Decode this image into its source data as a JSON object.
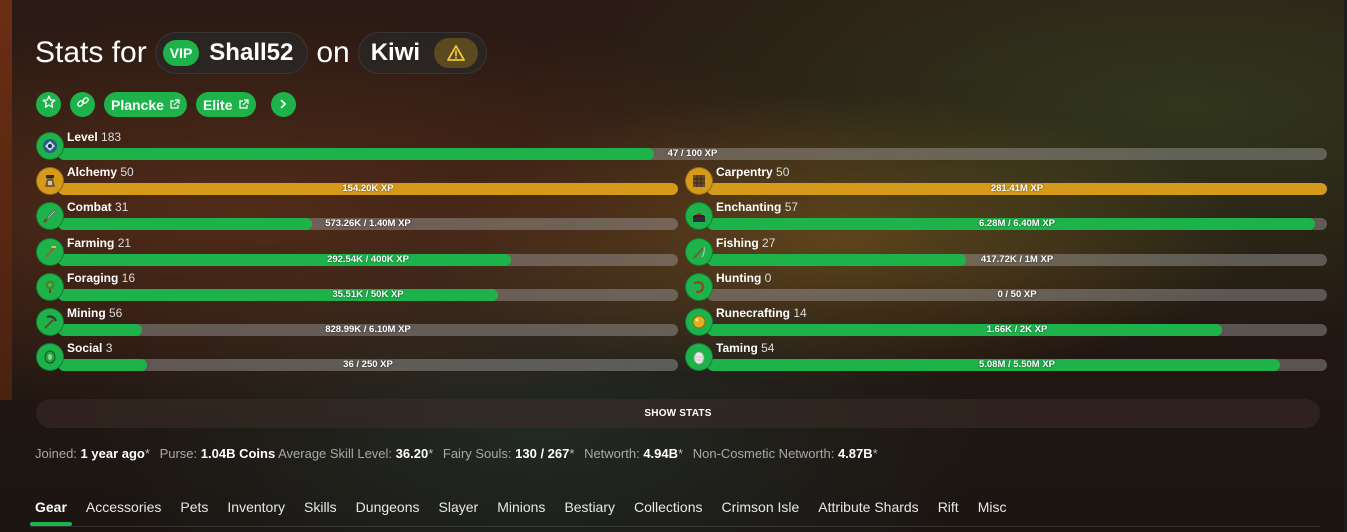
{
  "header": {
    "stats_for": "Stats for",
    "vip": "VIP",
    "username": "Shall52",
    "on": "on",
    "profile": "Kiwi"
  },
  "links": {
    "plancke": "Plancke",
    "elite": "Elite"
  },
  "level": {
    "name": "Level",
    "level": "183",
    "xp": "47 / 100 XP",
    "progress": 0.47
  },
  "skills_left": [
    {
      "name": "Alchemy",
      "level": "50",
      "xp": "154.20K XP",
      "progress": 1.0,
      "max": true,
      "icon": "alchemy-icon"
    },
    {
      "name": "Combat",
      "level": "31",
      "xp": "573.26K / 1.40M XP",
      "progress": 0.41,
      "max": false,
      "icon": "combat-icon"
    },
    {
      "name": "Farming",
      "level": "21",
      "xp": "292.54K / 400K XP",
      "progress": 0.73,
      "max": false,
      "icon": "farming-icon"
    },
    {
      "name": "Foraging",
      "level": "16",
      "xp": "35.51K / 50K XP",
      "progress": 0.71,
      "max": false,
      "icon": "foraging-icon"
    },
    {
      "name": "Mining",
      "level": "56",
      "xp": "828.99K / 6.10M XP",
      "progress": 0.136,
      "max": false,
      "icon": "mining-icon"
    },
    {
      "name": "Social",
      "level": "3",
      "xp": "36 / 250 XP",
      "progress": 0.144,
      "max": false,
      "icon": "social-icon"
    }
  ],
  "skills_right": [
    {
      "name": "Carpentry",
      "level": "50",
      "xp": "281.41M XP",
      "progress": 1.0,
      "max": true,
      "icon": "carpentry-icon"
    },
    {
      "name": "Enchanting",
      "level": "57",
      "xp": "6.28M / 6.40M XP",
      "progress": 0.981,
      "max": false,
      "icon": "enchanting-icon"
    },
    {
      "name": "Fishing",
      "level": "27",
      "xp": "417.72K / 1M XP",
      "progress": 0.418,
      "max": false,
      "icon": "fishing-icon"
    },
    {
      "name": "Hunting",
      "level": "0",
      "xp": "0 / 50 XP",
      "progress": 0.0,
      "max": false,
      "icon": "hunting-icon"
    },
    {
      "name": "Runecrafting",
      "level": "14",
      "xp": "1.66K / 2K XP",
      "progress": 0.83,
      "max": false,
      "icon": "runecrafting-icon"
    },
    {
      "name": "Taming",
      "level": "54",
      "xp": "5.08M / 5.50M XP",
      "progress": 0.924,
      "max": false,
      "icon": "taming-icon"
    }
  ],
  "show_stats": "SHOW STATS",
  "summary": {
    "joined_k": "Joined:",
    "joined_v": "1 year ago",
    "purse_k": "Purse:",
    "purse_v": "1.04B Coins",
    "avg_k": "Average Skill Level:",
    "avg_v": "36.20",
    "fairy_k": "Fairy Souls:",
    "fairy_v": "130 / 267",
    "networth_k": "Networth:",
    "networth_v": "4.94B",
    "noncos_k": "Non-Cosmetic Networth:",
    "noncos_v": "4.87B",
    "star": "*"
  },
  "tabs": [
    "Gear",
    "Accessories",
    "Pets",
    "Inventory",
    "Skills",
    "Dungeons",
    "Slayer",
    "Minions",
    "Bestiary",
    "Collections",
    "Crimson Isle",
    "Attribute Shards",
    "Rift",
    "Misc"
  ],
  "colors": {
    "accent": "#1db34a",
    "maxed": "#d69a1b",
    "warning": "#f0c040"
  }
}
